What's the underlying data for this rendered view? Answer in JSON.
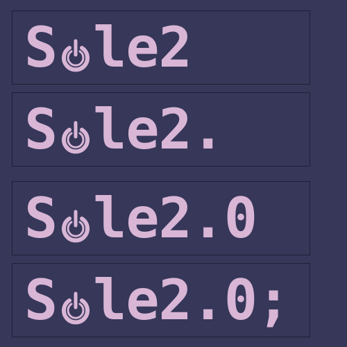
{
  "logos": [
    {
      "prefix": "S",
      "icon": "power-icon",
      "suffix": "le2"
    },
    {
      "prefix": "S",
      "icon": "power-icon",
      "suffix": "le2."
    },
    {
      "prefix": "S",
      "icon": "power-icon",
      "suffix": "le2.0"
    },
    {
      "prefix": "S",
      "icon": "power-icon",
      "suffix": "le2.0;"
    }
  ],
  "colors": {
    "background": "#363759",
    "text": "#d9b6d6",
    "border": "#1f2036"
  }
}
